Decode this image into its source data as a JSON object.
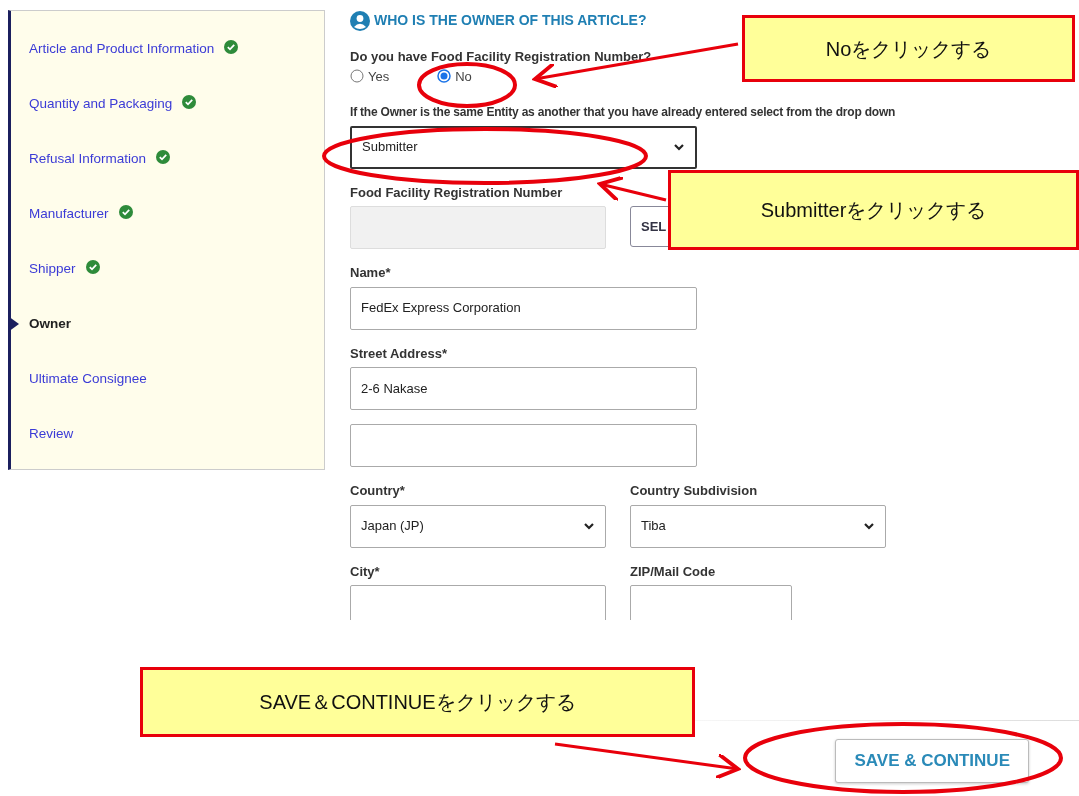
{
  "sidebar": {
    "items": [
      {
        "label": "Article and Product Information",
        "completed": true,
        "selected": false
      },
      {
        "label": "Quantity and Packaging",
        "completed": true,
        "selected": false
      },
      {
        "label": "Refusal Information",
        "completed": true,
        "selected": false
      },
      {
        "label": "Manufacturer",
        "completed": true,
        "selected": false
      },
      {
        "label": "Shipper",
        "completed": true,
        "selected": false
      },
      {
        "label": "Owner",
        "completed": false,
        "selected": true
      },
      {
        "label": "Ultimate Consignee",
        "completed": false,
        "selected": false
      },
      {
        "label": "Review",
        "completed": false,
        "selected": false
      }
    ]
  },
  "form": {
    "heading": "WHO IS THE OWNER OF THIS ARTICLE?",
    "question": "Do you have Food Facility Registration Number?",
    "radios": [
      {
        "label": "Yes",
        "selected": false
      },
      {
        "label": "No",
        "selected": true
      }
    ],
    "entity_label": "If the Owner is the same Entity as another that you have already entered select from the drop down",
    "entity_value": "Submitter",
    "ffr_label": "Food Facility Registration Number",
    "ffr_button": "SEL",
    "name_label": "Name*",
    "name_value": "FedEx Express Corporation",
    "street_label": "Street Address*",
    "street_value": "2-6 Nakase",
    "country_label": "Country*",
    "country_value": "Japan (JP)",
    "subdivision_label": "Country Subdivision",
    "subdivision_value": "Tiba",
    "city_label": "City*",
    "zip_label": "ZIP/Mail Code"
  },
  "save_button": "SAVE & CONTINUE",
  "callouts": [
    {
      "text": "Noをクリックする"
    },
    {
      "text": "Submitterをクリックする"
    },
    {
      "text": "SAVE＆CONTINUEをクリックする"
    }
  ]
}
